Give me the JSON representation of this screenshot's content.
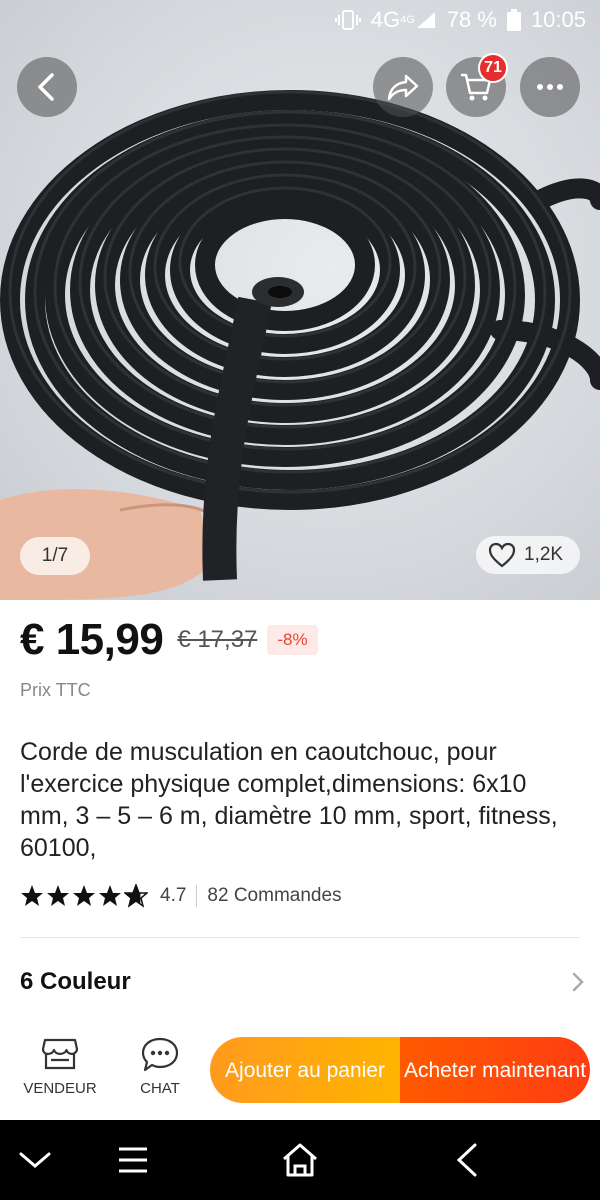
{
  "status_bar": {
    "network": "4G",
    "network_sup": "4G",
    "battery": "78 %",
    "time": "10:05"
  },
  "header": {
    "cart_count": "71",
    "icons": [
      "back-icon",
      "share-icon",
      "cart-icon",
      "more-icon"
    ]
  },
  "gallery": {
    "page_indicator": "1/7",
    "likes": "1,2K"
  },
  "product": {
    "price": "€ 15,99",
    "old_price": "€ 17,37",
    "discount": "-8%",
    "tax_note": "Prix TTC",
    "title": "Corde de musculation en caoutchouc, pour l'exercice physique complet,dimensions: 6x10 mm, 3 – 5 – 6 m, diamètre 10 mm, sport, fitness, 60100,",
    "rating": "4.7",
    "rating_stars": 4.7,
    "orders": "82 Commandes",
    "colors_label": "6 Couleur"
  },
  "action_bar": {
    "seller_label": "VENDEUR",
    "chat_label": "CHAT",
    "add_to_cart": "Ajouter au panier",
    "buy_now": "Acheter maintenant"
  },
  "colors": {
    "buy_orange": "#ff4a0a",
    "cart_orange": "#ffa513",
    "badge_red": "#e62e2e",
    "discount_text": "#e94434"
  }
}
